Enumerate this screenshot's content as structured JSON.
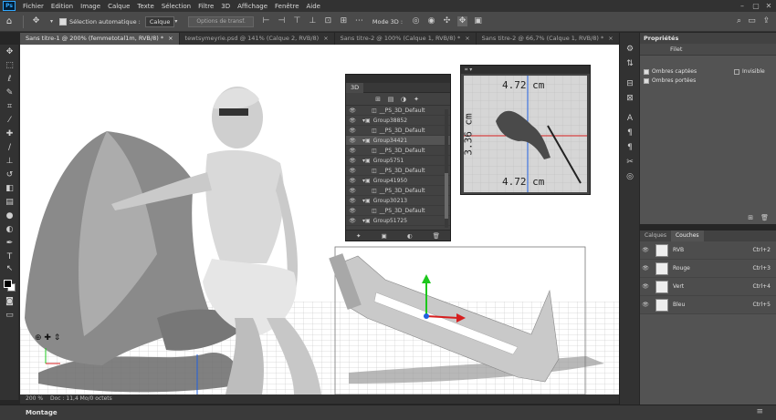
{
  "menubar": {
    "logo": "Ps",
    "items": [
      "Fichier",
      "Edition",
      "Image",
      "Calque",
      "Texte",
      "Sélection",
      "Filtre",
      "3D",
      "Affichage",
      "Fenêtre",
      "Aide"
    ]
  },
  "options": {
    "auto_select_label": "Sélection automatique :",
    "auto_select_value": "Calque",
    "transform_button": "Options de transf.",
    "mode3d_label": "Mode 3D :"
  },
  "tabs": [
    {
      "label": "Sans titre-1 @ 200% (femmetotal1m, RVB/8) *",
      "active": true
    },
    {
      "label": "tewtsymeyrie.psd @ 141% (Calque 2, RVB/8)",
      "active": false
    },
    {
      "label": "Sans titre-2 @ 100% (Calque 1, RVB/8) *",
      "active": false
    },
    {
      "label": "Sans titre-2 @ 66,7% (Calque 1, RVB/8) *",
      "active": false
    }
  ],
  "panel3d": {
    "tab": "3D",
    "rows": [
      {
        "label": "__PS_3D_Default",
        "indent": 1,
        "selected": false
      },
      {
        "label": "Group38852",
        "indent": 0,
        "selected": false
      },
      {
        "label": "__PS_3D_Default",
        "indent": 1,
        "selected": false
      },
      {
        "label": "Group34421",
        "indent": 0,
        "selected": true
      },
      {
        "label": "__PS_3D_Default",
        "indent": 1,
        "selected": false
      },
      {
        "label": "Group5751",
        "indent": 0,
        "selected": false
      },
      {
        "label": "__PS_3D_Default",
        "indent": 1,
        "selected": false
      },
      {
        "label": "Group41950",
        "indent": 0,
        "selected": false
      },
      {
        "label": "__PS_3D_Default",
        "indent": 1,
        "selected": false
      },
      {
        "label": "Group30213",
        "indent": 0,
        "selected": false
      },
      {
        "label": "__PS_3D_Default",
        "indent": 1,
        "selected": false
      },
      {
        "label": "Group51725",
        "indent": 0,
        "selected": false
      }
    ]
  },
  "secondary_view": {
    "width_measure": "4.72 cm",
    "height_measure": "3.36 cm",
    "width_measure_bottom": "4.72 cm"
  },
  "properties": {
    "title": "Propriétés",
    "subtitle": "Filet",
    "options": [
      {
        "label": "Ombres captées",
        "checked": true
      },
      {
        "label": "Invisible",
        "checked": false
      },
      {
        "label": "Ombres portées",
        "checked": true
      }
    ]
  },
  "channels": {
    "tabs": [
      {
        "label": "Calques",
        "active": false
      },
      {
        "label": "Couches",
        "active": true
      }
    ],
    "rows": [
      {
        "name": "RVB",
        "key": "Ctrl+2"
      },
      {
        "name": "Rouge",
        "key": "Ctrl+3"
      },
      {
        "name": "Vert",
        "key": "Ctrl+4"
      },
      {
        "name": "Bleu",
        "key": "Ctrl+5"
      }
    ]
  },
  "status": {
    "zoom": "200 %",
    "doc": "Doc : 11,4 Mo/0 octets"
  },
  "timeline": {
    "label": "Montage"
  },
  "colors": {
    "accent": "#31a8ff",
    "axis_red": "#d61f1f",
    "axis_green": "#1cc71c",
    "axis_blue": "#2060e0"
  }
}
